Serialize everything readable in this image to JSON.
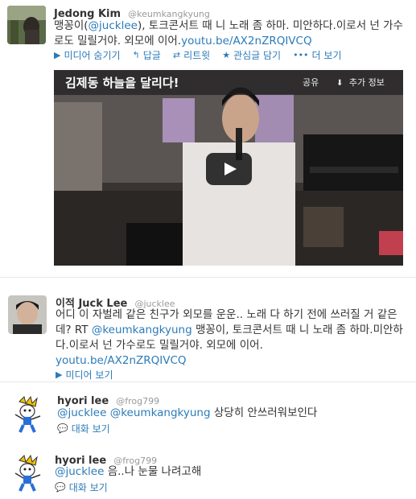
{
  "tweets": [
    {
      "name": "Jedong Kim",
      "handle": "@keumkangkyung",
      "text_before": "맹꽁이(",
      "mention": "@jucklee",
      "text_middle": "), 토크콘서트 때 니 노래 좀 하마. 미안하다.이로서 넌 가수로도 밀릴거야. 외모에 이어.",
      "link": "youtu.be/AX2nZRQIVCQ",
      "actions": {
        "hide_media": "미디어 숨기기",
        "reply": "답글",
        "retweet": "리트윗",
        "favorite": "관심글 담기",
        "more": "더 보기"
      },
      "video": {
        "title": "김제동 하늘을 달리다!",
        "share": "공유",
        "more_info": "추가 정보"
      }
    },
    {
      "name": "이적 Juck Lee",
      "handle": "@jucklee",
      "text_before": "어디 이 자벌레 같은 친구가 외모를 운운.. 노래 다 하기 전에 쓰러질 거 같은데? RT ",
      "mention": "@keumkangkyung",
      "text_middle": " 맹꽁이, 토크콘서트 때 니 노래 좀 하마.미안하다.이로서 넌 가수로도 밀릴거야. 외모에 이어.",
      "link": "youtu.be/AX2nZRQIVCQ",
      "action": "미디어 보기"
    },
    {
      "name": "hyori lee",
      "handle": "@frog799",
      "mention1": "@jucklee",
      "mention2": "@keumkangkyung",
      "text": " 상당히 안쓰러워보인다",
      "action": "대화 보기"
    },
    {
      "name": "hyori lee",
      "handle": "@frog799",
      "mention1": "@jucklee",
      "text": " 음..나 눈물 나려고해",
      "action": "대화 보기"
    }
  ]
}
